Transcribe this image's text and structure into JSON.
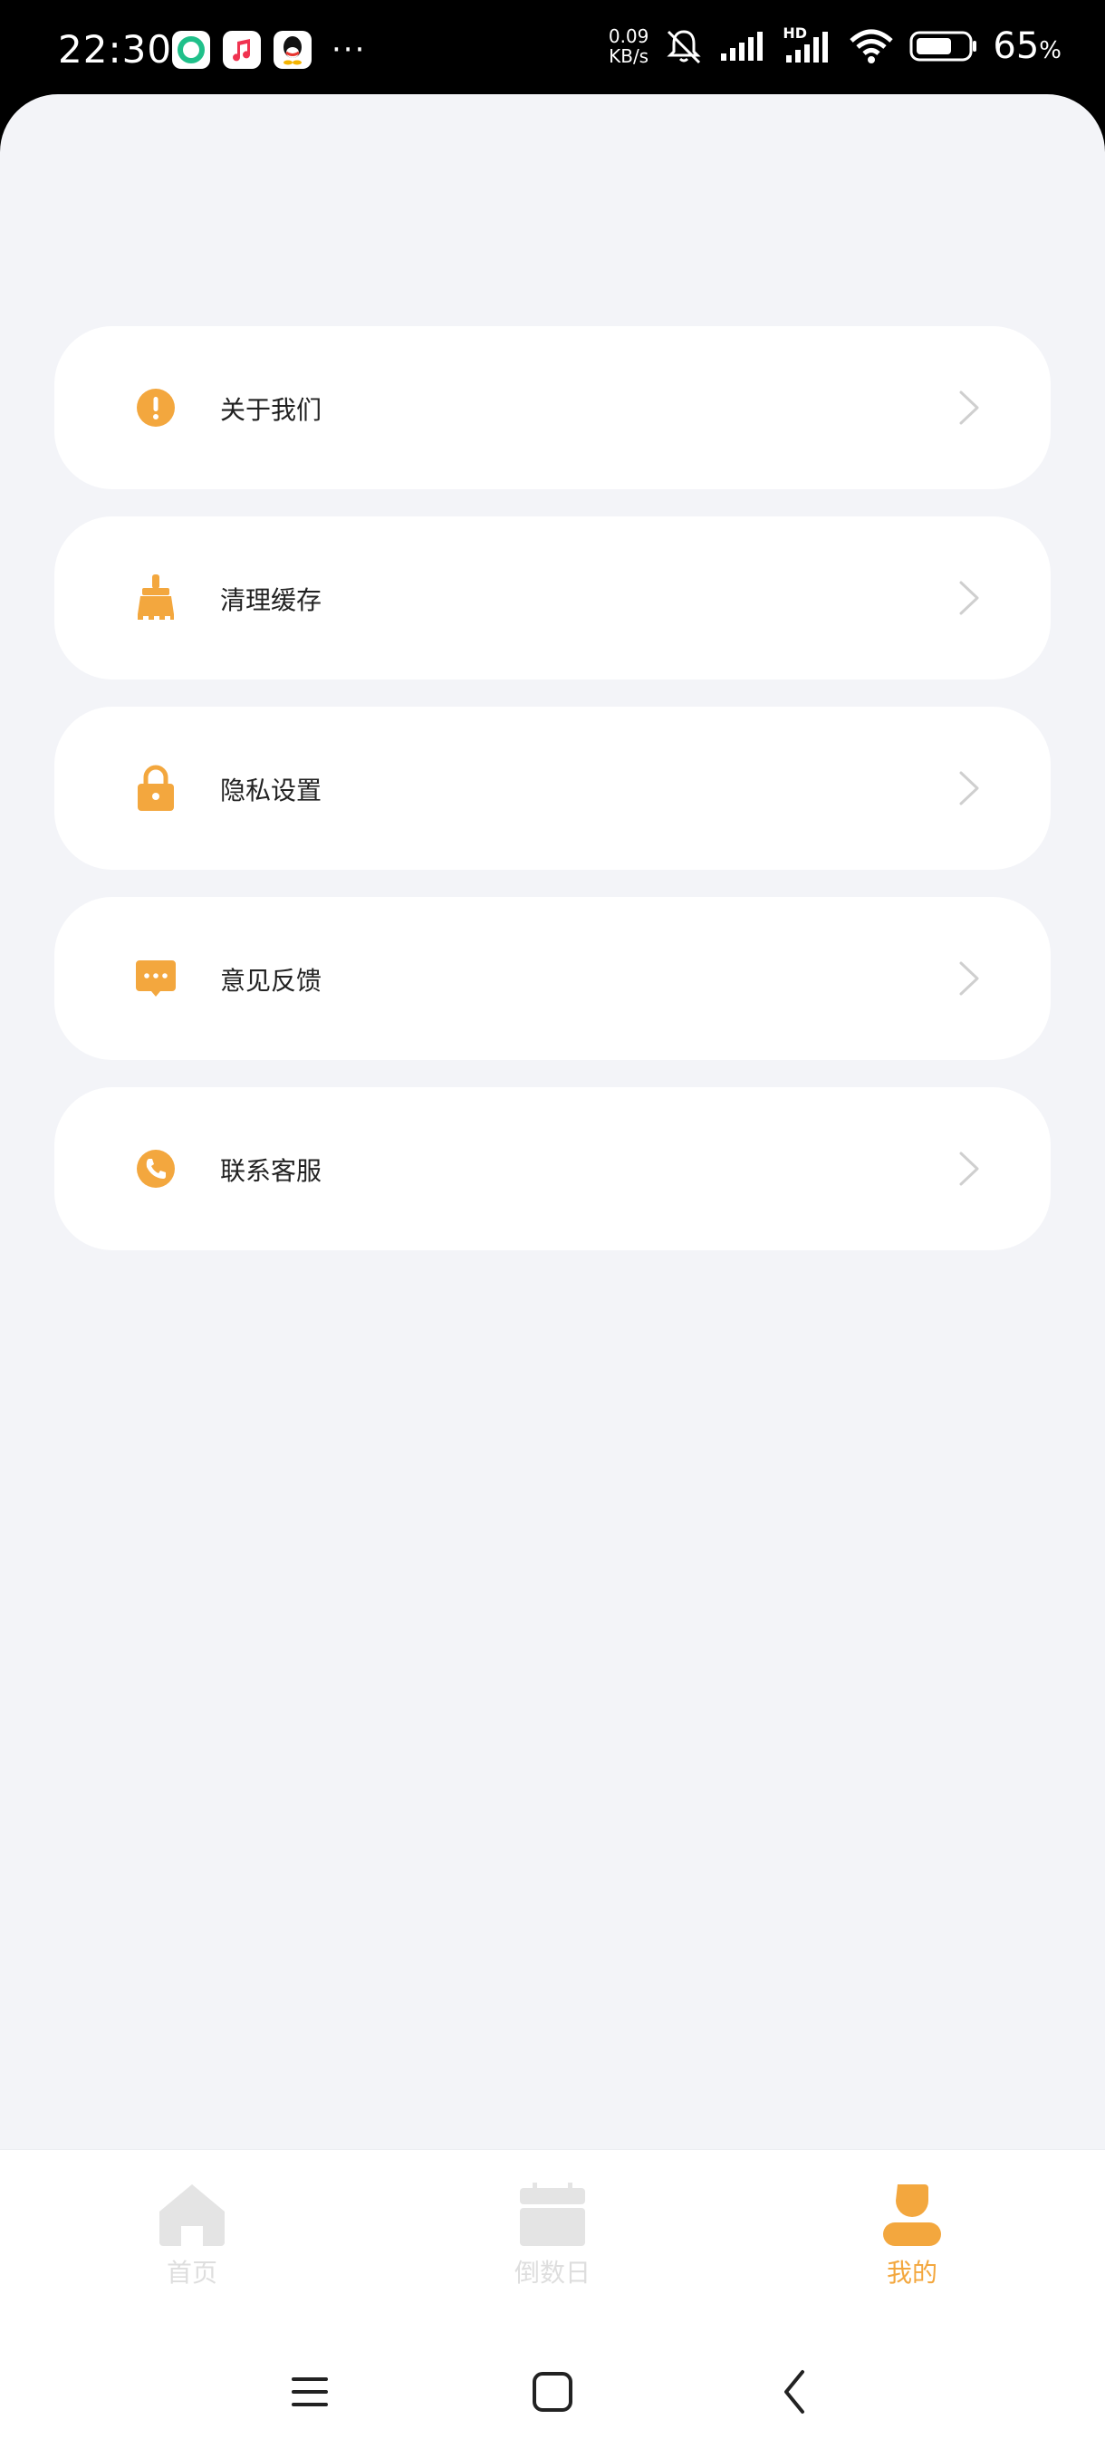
{
  "status_bar": {
    "time": "22:30",
    "net_speed_value": "0.09",
    "net_speed_unit": "KB/s",
    "battery_percent": "65",
    "battery_percent_sign": "%",
    "hd_label": "HD"
  },
  "menu": [
    {
      "label": "关于我们",
      "icon": "info-icon"
    },
    {
      "label": "清理缓存",
      "icon": "broom-icon"
    },
    {
      "label": "隐私设置",
      "icon": "lock-icon"
    },
    {
      "label": "意见反馈",
      "icon": "feedback-icon"
    },
    {
      "label": "联系客服",
      "icon": "phone-icon"
    }
  ],
  "tabs": [
    {
      "label": "首页",
      "icon": "home-icon",
      "active": false
    },
    {
      "label": "倒数日",
      "icon": "calendar-icon",
      "active": false
    },
    {
      "label": "我的",
      "icon": "user-icon",
      "active": true
    }
  ],
  "colors": {
    "accent": "#f3a73e",
    "background": "#f3f4f8",
    "card": "#ffffff",
    "inactive_tab": "#dedede"
  }
}
